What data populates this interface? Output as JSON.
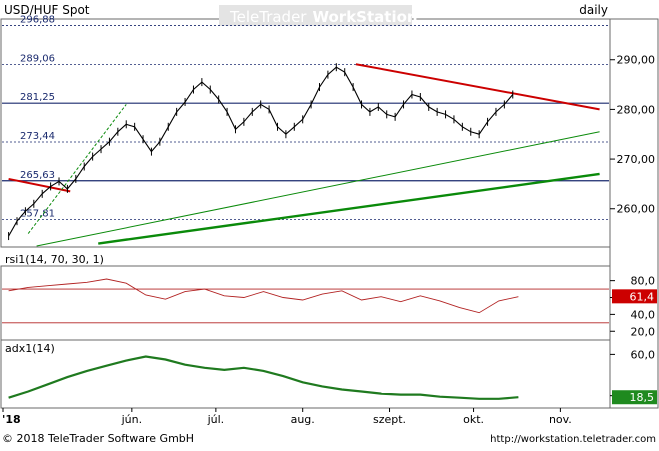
{
  "header": {
    "instrument": "USD/HUF Spot",
    "watermark_part1": "TeleTrader",
    "watermark_part2": "WorkStation",
    "period": "daily"
  },
  "footer": {
    "copyright": "© 2018 TeleTrader Software GmbH",
    "url": "http://workstation.teletrader.com"
  },
  "colors": {
    "price_line": "#000000",
    "trend_red": "#cc0000",
    "trend_green": "#0a8a0a",
    "level_line": "#1a2a6e",
    "rsi_line": "#b22222",
    "adx_line": "#1f7a1f",
    "rsi_badge": "#cc0000",
    "adx_badge": "#1f8a1f"
  },
  "chart_data": [
    {
      "type": "line",
      "title": "USD/HUF Spot",
      "x_tick_labels": [
        "'18",
        "jún.",
        "júl.",
        "aug.",
        "szept.",
        "okt.",
        "nov."
      ],
      "y_tick_labels": [
        "260,00",
        "270,00",
        "280,00",
        "290,00"
      ],
      "ylim": [
        252.5,
        298
      ],
      "grid": false,
      "level_labels": [
        "296,88",
        "289,06",
        "281,25",
        "273,44",
        "265,63",
        "257,81"
      ],
      "levels": [
        296.88,
        289.06,
        281.25,
        273.44,
        265.63,
        257.81
      ],
      "trendlines": [
        {
          "color": "red",
          "from": [
            "2018-04-18",
            266.0
          ],
          "to": [
            "2018-05-10",
            263.5
          ]
        },
        {
          "color": "red",
          "from": [
            "2018-08-20",
            289.1
          ],
          "to": [
            "2018-11-15",
            280.0
          ]
        },
        {
          "color": "green",
          "from": [
            "2018-04-28",
            252.5
          ],
          "to": [
            "2018-11-15",
            275.5
          ]
        },
        {
          "color": "green",
          "from": [
            "2018-05-20",
            253.0
          ],
          "to": [
            "2018-11-15",
            267.0
          ]
        },
        {
          "color": "green",
          "from": [
            "2018-04-25",
            255.0
          ],
          "to": [
            "2018-05-30",
            281.0
          ]
        }
      ],
      "series": [
        {
          "values_note": "daily close, estimated",
          "x": [
            "2018-04-18",
            "2018-04-21",
            "2018-04-24",
            "2018-04-27",
            "2018-04-30",
            "2018-05-03",
            "2018-05-06",
            "2018-05-09",
            "2018-05-12",
            "2018-05-15",
            "2018-05-18",
            "2018-05-21",
            "2018-05-24",
            "2018-05-27",
            "2018-05-30",
            "2018-06-02",
            "2018-06-05",
            "2018-06-08",
            "2018-06-11",
            "2018-06-14",
            "2018-06-17",
            "2018-06-20",
            "2018-06-23",
            "2018-06-26",
            "2018-06-29",
            "2018-07-02",
            "2018-07-05",
            "2018-07-08",
            "2018-07-11",
            "2018-07-14",
            "2018-07-17",
            "2018-07-20",
            "2018-07-23",
            "2018-07-26",
            "2018-07-29",
            "2018-08-01",
            "2018-08-04",
            "2018-08-07",
            "2018-08-10",
            "2018-08-13",
            "2018-08-16",
            "2018-08-19",
            "2018-08-22",
            "2018-08-25",
            "2018-08-28",
            "2018-08-31",
            "2018-09-03",
            "2018-09-06",
            "2018-09-09",
            "2018-09-12",
            "2018-09-15",
            "2018-09-18",
            "2018-09-21",
            "2018-09-24",
            "2018-09-27",
            "2018-09-30",
            "2018-10-03",
            "2018-10-06",
            "2018-10-09",
            "2018-10-12",
            "2018-10-15"
          ],
          "values": [
            254.5,
            257.5,
            259.5,
            261.0,
            263.0,
            264.5,
            265.5,
            264.0,
            266.0,
            268.5,
            270.5,
            272.0,
            273.5,
            275.5,
            277.0,
            276.5,
            274.0,
            271.5,
            273.5,
            276.5,
            279.5,
            281.5,
            284.0,
            285.5,
            284.0,
            282.0,
            279.5,
            276.0,
            277.5,
            279.5,
            281.0,
            280.0,
            276.5,
            275.0,
            276.5,
            278.0,
            281.0,
            284.5,
            287.0,
            288.5,
            287.5,
            284.5,
            281.0,
            279.5,
            280.5,
            279.0,
            278.5,
            281.0,
            283.0,
            282.5,
            280.5,
            279.5,
            279.0,
            278.0,
            276.5,
            275.5,
            275.0,
            277.5,
            279.5,
            281.0,
            283.0
          ]
        }
      ]
    },
    {
      "type": "line",
      "title": "rsi1(14, 70, 30, 1)",
      "y_tick_labels": [
        "20,0",
        "40,0",
        "60,0",
        "80,0"
      ],
      "ylim": [
        12,
        95
      ],
      "bands": [
        30,
        70
      ],
      "current_value": "61,4",
      "series": [
        {
          "x": [
            "2018-04-18",
            "2018-04-25",
            "2018-05-02",
            "2018-05-09",
            "2018-05-16",
            "2018-05-23",
            "2018-05-30",
            "2018-06-06",
            "2018-06-13",
            "2018-06-20",
            "2018-06-27",
            "2018-07-04",
            "2018-07-11",
            "2018-07-18",
            "2018-07-25",
            "2018-08-01",
            "2018-08-08",
            "2018-08-15",
            "2018-08-22",
            "2018-08-29",
            "2018-09-05",
            "2018-09-12",
            "2018-09-19",
            "2018-09-26",
            "2018-10-03",
            "2018-10-10",
            "2018-10-17"
          ],
          "values": [
            68,
            72,
            74,
            76,
            78,
            82,
            77,
            63,
            58,
            67,
            70,
            62,
            60,
            67,
            60,
            57,
            64,
            68,
            57,
            61,
            55,
            62,
            56,
            48,
            42,
            56,
            61
          ]
        }
      ]
    },
    {
      "type": "area",
      "title": "adx1(14)",
      "y_tick_labels": [
        "20,0",
        "60,0"
      ],
      "ylim": [
        10,
        72
      ],
      "current_value": "18,5",
      "series": [
        {
          "x": [
            "2018-04-18",
            "2018-04-25",
            "2018-05-02",
            "2018-05-09",
            "2018-05-16",
            "2018-05-23",
            "2018-05-30",
            "2018-06-06",
            "2018-06-13",
            "2018-06-20",
            "2018-06-27",
            "2018-07-04",
            "2018-07-11",
            "2018-07-18",
            "2018-07-25",
            "2018-08-01",
            "2018-08-08",
            "2018-08-15",
            "2018-08-22",
            "2018-08-29",
            "2018-09-05",
            "2018-09-12",
            "2018-09-19",
            "2018-09-26",
            "2018-10-03",
            "2018-10-10",
            "2018-10-17"
          ],
          "values": [
            18,
            24,
            31,
            38,
            44,
            49,
            54,
            58,
            55,
            50,
            47,
            45,
            47,
            44,
            39,
            33,
            29,
            26,
            24,
            22,
            21,
            21,
            19,
            18,
            17,
            17,
            18.5
          ]
        }
      ]
    }
  ]
}
